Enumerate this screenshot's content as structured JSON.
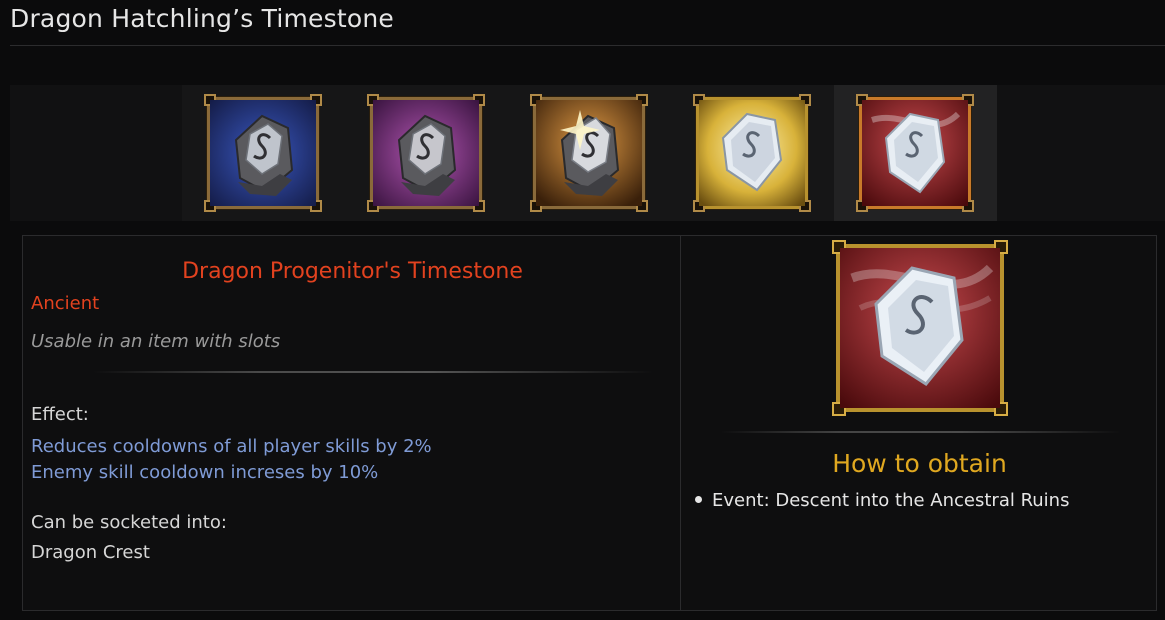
{
  "page": {
    "title": "Dragon Hatchling’s Timestone"
  },
  "variants": [
    {
      "name": "tier-1",
      "bg": "#2c3f8f",
      "frame": "#8a6a3a",
      "selected": false
    },
    {
      "name": "tier-2",
      "bg": "#8a3f8a",
      "frame": "#8a6a3a",
      "selected": false
    },
    {
      "name": "tier-3",
      "bg": "#b8702c",
      "frame": "#8a6a3a",
      "selected": false
    },
    {
      "name": "tier-4",
      "bg": "#d8b23a",
      "frame": "#b8922e",
      "selected": false
    },
    {
      "name": "tier-5",
      "bg": "#a31a1e",
      "frame": "#c87a2a",
      "selected": true
    }
  ],
  "item": {
    "name": "Dragon Progenitor's Timestone",
    "rarity": "Ancient",
    "usage": "Usable in an item with slots",
    "effect_label": "Effect:",
    "effects": [
      "Reduces cooldowns of all player skills by 2%",
      "Enemy skill cooldown increses by 10%"
    ],
    "socket_label": "Can be socketed into:",
    "socket_value": "Dragon Crest"
  },
  "obtain": {
    "title": "How to obtain",
    "items": [
      "Event: Descent into the Ancestral Ruins"
    ]
  },
  "colors": {
    "rarity_ancient": "#e2421f",
    "effect_blue": "#7f9bd6",
    "obtain_gold": "#e0a820"
  }
}
